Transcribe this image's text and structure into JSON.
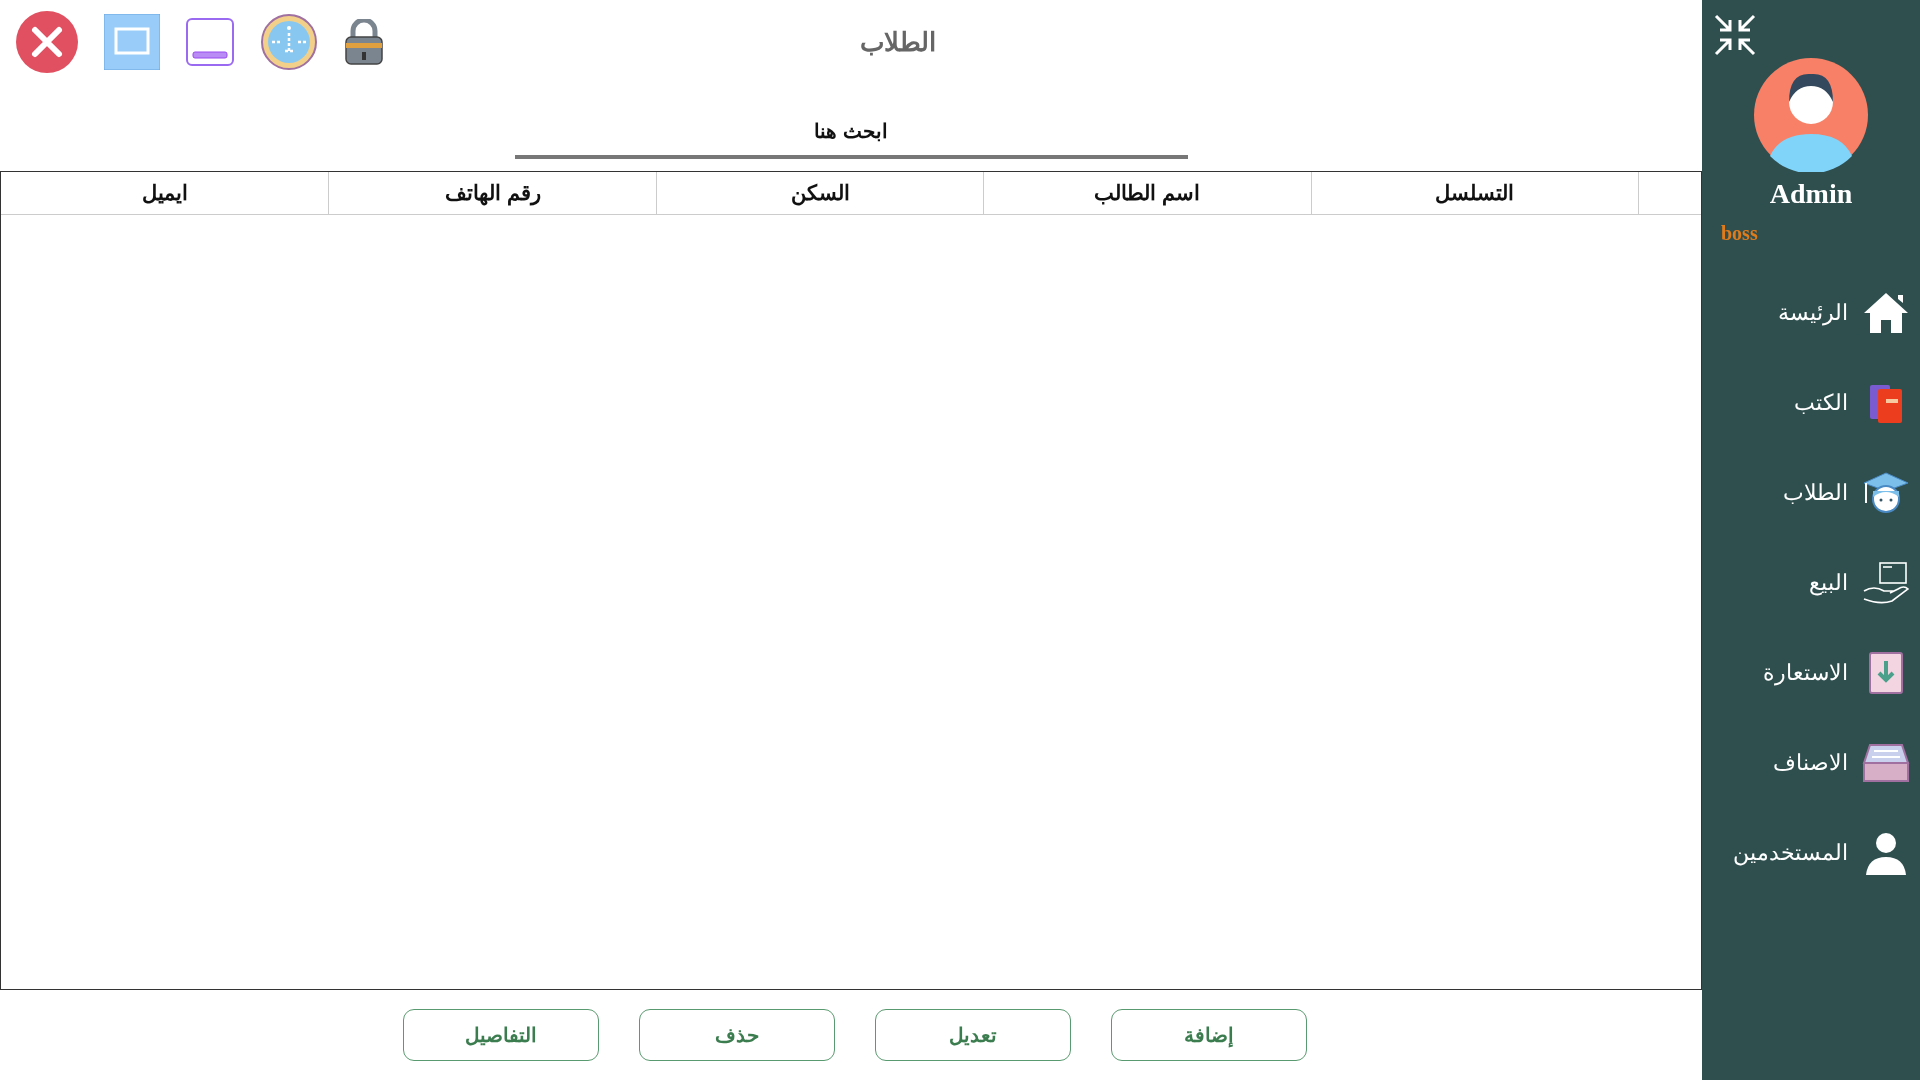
{
  "window": {
    "title": "الطلاب"
  },
  "search": {
    "placeholder": "ابحث هنا"
  },
  "table": {
    "columns": [
      "التسلسل",
      "اسم الطالب",
      "السكن",
      "رقم الهاتف",
      "ايميل"
    ]
  },
  "buttons": [
    "إضافة",
    "تعديل",
    "حذف",
    "التفاصيل"
  ],
  "user": {
    "name": "Admin",
    "role": "boss"
  },
  "sidebar": {
    "items": [
      {
        "label": "الرئيسة",
        "kind": "home",
        "selected": false
      },
      {
        "label": "الكتب",
        "kind": "books",
        "selected": false
      },
      {
        "label": "الطلاب",
        "kind": "students",
        "selected": false
      },
      {
        "label": "البيع",
        "kind": "sale",
        "selected": false
      },
      {
        "label": "الاستعارة",
        "kind": "borrow",
        "selected": false
      },
      {
        "label": "الاصناف",
        "kind": "categories",
        "selected": false
      },
      {
        "label": "المستخدمين",
        "kind": "users",
        "selected": false
      }
    ]
  }
}
